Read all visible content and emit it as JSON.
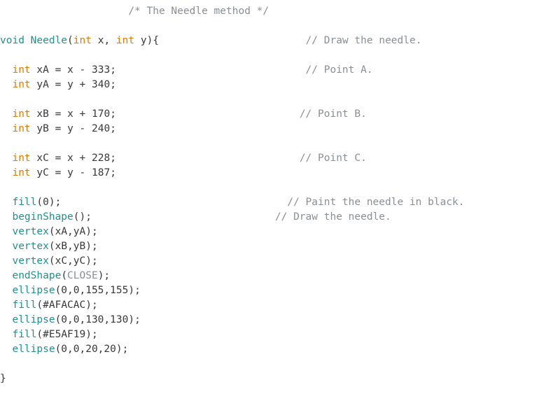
{
  "code": {
    "c_header": "/* The Needle method */",
    "kw_void": "void",
    "fn_needle": "Needle",
    "type_int": "int",
    "param_x": "x",
    "param_y": "y",
    "c_draw_needle": "// Draw the needle.",
    "var_xA": "xA",
    "xA_expr": " = x - ",
    "xA_val": "333",
    "c_pointA": "// Point A.",
    "var_yA": "yA",
    "yA_expr": " = y + ",
    "yA_val": "340",
    "var_xB": "xB",
    "xB_expr": " = x + ",
    "xB_val": "170",
    "c_pointB": "// Point B.",
    "var_yB": "yB",
    "yB_expr": " = y - ",
    "yB_val": "240",
    "var_xC": "xC",
    "xC_expr": " = x + ",
    "xC_val": "228",
    "c_pointC": "// Point C.",
    "var_yC": "yC",
    "yC_expr": " = y - ",
    "yC_val": "187",
    "fn_fill": "fill",
    "fill0_arg": "0",
    "c_paint_black": "// Paint the needle in black.",
    "fn_beginShape": "beginShape",
    "c_draw_needle2": "// Draw the needle.",
    "fn_vertex": "vertex",
    "vertex1_args": "(xA,yA);",
    "vertex2_args": "(xB,yB);",
    "vertex3_args": "(xC,yC);",
    "fn_endShape": "endShape",
    "const_close": "CLOSE",
    "fn_ellipse": "ellipse",
    "ellipse1_args": "(0,0,155,155);",
    "fill_hex1": "#AFACAC",
    "ellipse2_args": "(0,0,130,130);",
    "fill_hex2": "#E5AF19",
    "ellipse3_args": "(0,0,20,20);",
    "brace_close": "}"
  }
}
